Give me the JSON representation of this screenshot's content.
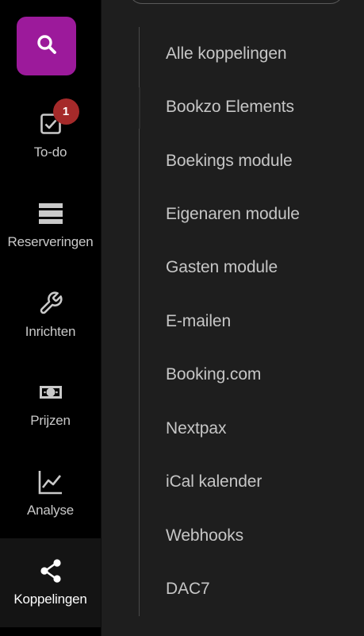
{
  "colors": {
    "accent": "#9c1a9b",
    "badge": "#a52a2a",
    "rail_background": "#000000",
    "panel_background": "#1e1e1e"
  },
  "search": {
    "icon": "search-icon"
  },
  "nav": {
    "items": [
      {
        "label": "To-do",
        "icon": "checkbox-icon",
        "badge": "1"
      },
      {
        "label": "Reserveringen",
        "icon": "calendar-rows-icon"
      },
      {
        "label": "Inrichten",
        "icon": "wrench-icon"
      },
      {
        "label": "Prijzen",
        "icon": "money-icon"
      },
      {
        "label": "Analyse",
        "icon": "chart-icon"
      },
      {
        "label": "Koppelingen",
        "icon": "share-icon",
        "active": true
      }
    ]
  },
  "submenu": {
    "items": [
      "Alle koppelingen",
      "Bookzo Elements",
      "Boekings module",
      "Eigenaren module",
      "Gasten module",
      "E-mailen",
      "Booking.com",
      "Nextpax",
      "iCal kalender",
      "Webhooks",
      "DAC7"
    ]
  }
}
